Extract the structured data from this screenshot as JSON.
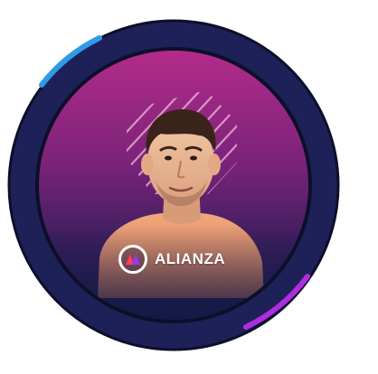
{
  "badge": {
    "brand_name": "ALIANZA",
    "logo_icon": "alianza-logo-icon",
    "portrait_icon": "person-portrait-icon",
    "pattern_icon": "hatched-pattern-icon"
  },
  "colors": {
    "outer_ring": "#1d2157",
    "ring_outline": "#0d0f2a",
    "accent_blue": "#2f9be8",
    "accent_purple": "#b02ce0",
    "gradient_top": "#b32b8a",
    "gradient_mid": "#5c2272",
    "gradient_bottom": "#151a45",
    "logo_red": "#ff3d5a",
    "logo_purple": "#9b3cf0"
  }
}
